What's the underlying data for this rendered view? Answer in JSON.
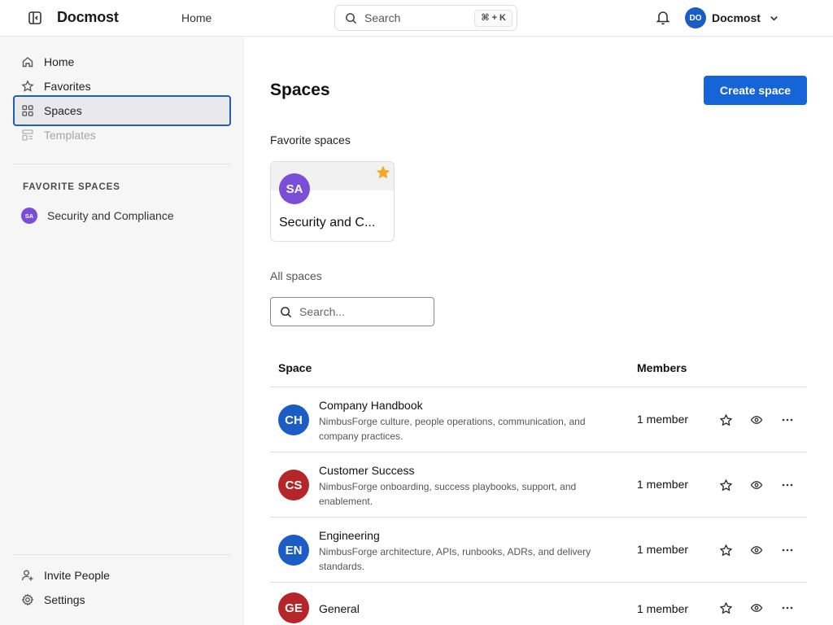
{
  "header": {
    "brand": "Docmost",
    "nav_home": "Home",
    "search_placeholder": "Search",
    "search_shortcut": "⌘ + K",
    "user_initials": "DO",
    "user_name": "Docmost"
  },
  "sidebar": {
    "items": [
      {
        "label": "Home",
        "icon": "home-icon"
      },
      {
        "label": "Favorites",
        "icon": "star-icon"
      },
      {
        "label": "Spaces",
        "icon": "grid-icon",
        "active": true
      },
      {
        "label": "Templates",
        "icon": "template-icon",
        "disabled": true
      }
    ],
    "favorite_spaces_title": "FAVORITE SPACES",
    "favorite_spaces": [
      {
        "initials": "SA",
        "name": "Security and Compliance",
        "color": "#7b4ed8"
      }
    ],
    "bottom_items": [
      {
        "label": "Invite People",
        "icon": "user-plus-icon"
      },
      {
        "label": "Settings",
        "icon": "gear-icon"
      }
    ]
  },
  "main": {
    "title": "Spaces",
    "create_button": "Create space",
    "favorite_heading": "Favorite spaces",
    "favorite_card": {
      "initials": "SA",
      "name": "Security and C...",
      "color": "#7b4ed8"
    },
    "all_heading": "All spaces",
    "search_placeholder": "Search...",
    "table": {
      "columns": [
        "Space",
        "Members"
      ],
      "rows": [
        {
          "initials": "CH",
          "name": "Company Handbook",
          "description": "NimbusForge culture, people operations, communication, and company practices.",
          "members": "1 member",
          "color": "#1c5cc5"
        },
        {
          "initials": "CS",
          "name": "Customer Success",
          "description": "NimbusForge onboarding, success playbooks, support, and enablement.",
          "members": "1 member",
          "color": "#b5262b"
        },
        {
          "initials": "EN",
          "name": "Engineering",
          "description": "NimbusForge architecture, APIs, runbooks, ADRs, and delivery standards.",
          "members": "1 member",
          "color": "#1c5cc5"
        },
        {
          "initials": "GE",
          "name": "General",
          "description": "",
          "members": "1 member",
          "color": "#b5262b"
        }
      ]
    }
  },
  "colors": {
    "accent": "#1565d8",
    "star": "#f5a623"
  }
}
